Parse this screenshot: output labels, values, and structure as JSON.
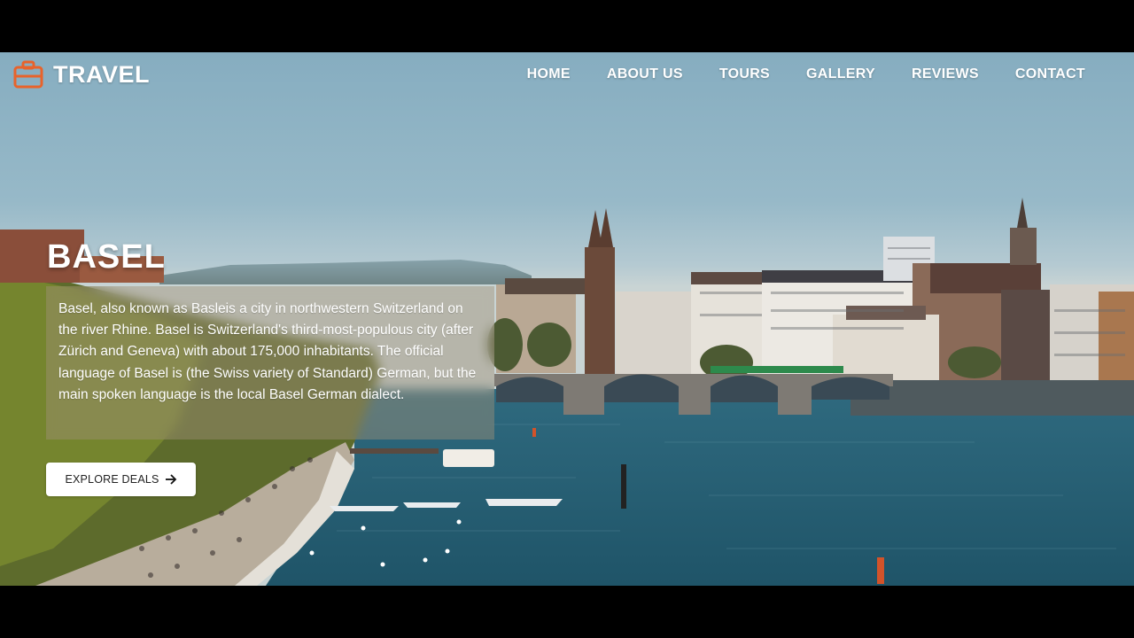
{
  "brand": {
    "name": "TRAVEL",
    "icon": "briefcase-icon",
    "accent": "#e8632b"
  },
  "nav": {
    "items": [
      {
        "label": "HOME"
      },
      {
        "label": "ABOUT US"
      },
      {
        "label": "TOURS"
      },
      {
        "label": "GALLERY"
      },
      {
        "label": "REVIEWS"
      },
      {
        "label": "CONTACT"
      }
    ]
  },
  "hero": {
    "title": "BASEL",
    "description": "Basel, also known as Basleis a city in northwestern Switzerland on the river Rhine. Basel is Switzerland's third-most-populous city (after Zürich and Geneva) with about 175,000 inhabitants. The official language of Basel is (the Swiss variety of Standard) German, but the main spoken language is the local Basel German dialect.",
    "cta": {
      "label": "EXPLORE DEALS",
      "icon": "arrow-right-icon"
    }
  }
}
